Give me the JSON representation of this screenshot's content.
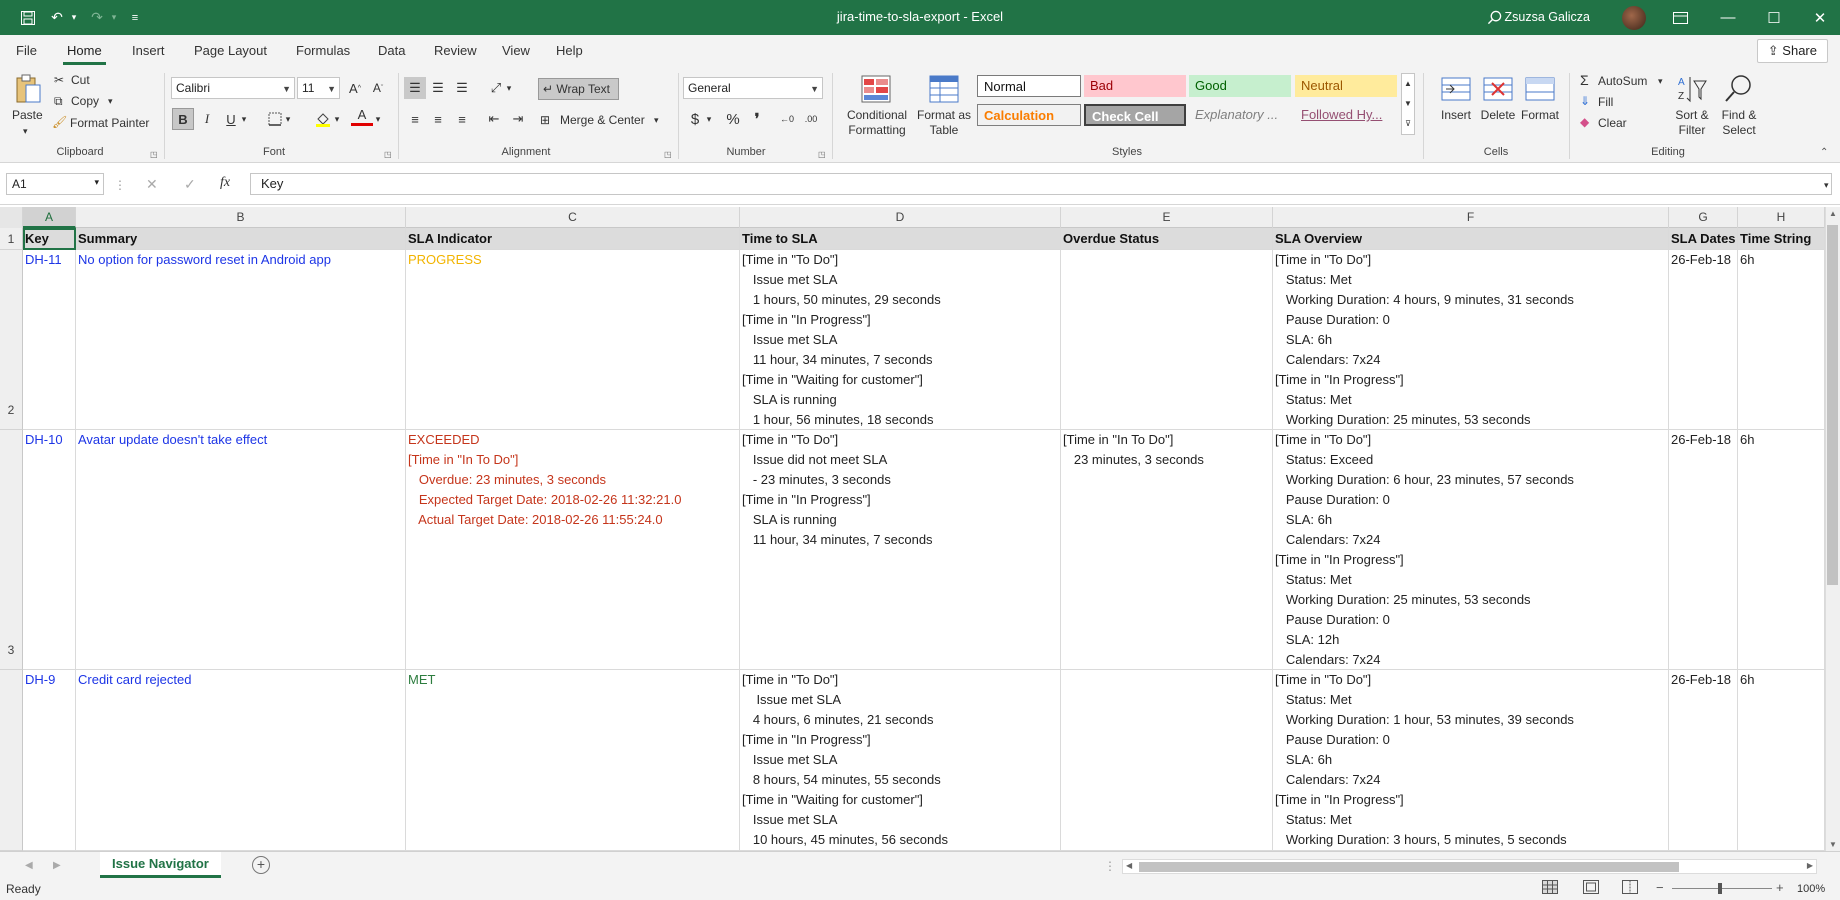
{
  "app": {
    "title": "jira-time-to-sla-export  -  Excel",
    "user": "Zsuzsa Galicza"
  },
  "menu": {
    "tabs": [
      "File",
      "Home",
      "Insert",
      "Page Layout",
      "Formulas",
      "Data",
      "Review",
      "View",
      "Help"
    ],
    "share": "Share"
  },
  "ribbon": {
    "clipboard": {
      "paste": "Paste",
      "cut": "Cut",
      "copy": "Copy",
      "format_painter": "Format Painter",
      "label": "Clipboard"
    },
    "font": {
      "name": "Calibri",
      "size": "11",
      "label": "Font"
    },
    "alignment": {
      "wrap": "Wrap Text",
      "merge": "Merge & Center",
      "label": "Alignment"
    },
    "number": {
      "format": "General",
      "label": "Number"
    },
    "styles": {
      "conditional": "Conditional",
      "conditional2": "Formatting",
      "format_as": "Format as",
      "table": "Table",
      "normal": "Normal",
      "bad": "Bad",
      "good": "Good",
      "neutral": "Neutral",
      "calculation": "Calculation",
      "check": "Check Cell",
      "explanatory": "Explanatory ...",
      "followed": "Followed Hy...",
      "label": "Styles"
    },
    "cells": {
      "insert": "Insert",
      "delete": "Delete",
      "format": "Format",
      "label": "Cells"
    },
    "editing": {
      "autosum": "AutoSum",
      "fill": "Fill",
      "clear": "Clear",
      "sort": "Sort &",
      "filter": "Filter",
      "find": "Find &",
      "select": "Select",
      "label": "Editing"
    }
  },
  "formula": {
    "namebox": "A1",
    "content": "Key"
  },
  "columns": [
    "A",
    "B",
    "C",
    "D",
    "E",
    "F",
    "G",
    "H"
  ],
  "rows": [
    "1",
    "2",
    "3"
  ],
  "headers": [
    "Key",
    "Summary",
    "SLA Indicator",
    "Time to SLA",
    "Overdue Status",
    "SLA Overview",
    "SLA Dates",
    "Time String"
  ],
  "issues": [
    {
      "key": "DH-11",
      "summary": "No option for password reset in Android app",
      "indicator": "PROGRESS",
      "indicator_color": "#f2b400",
      "time_to_sla": "[Time in \"To Do\"]\n   Issue met SLA\n   1 hours, 50 minutes, 29 seconds\n[Time in \"In Progress\"]\n   Issue met SLA\n   11 hour, 34 minutes, 7 seconds\n[Time in \"Waiting for customer\"]\n   SLA is running\n   1 hour, 56 minutes, 18 seconds",
      "overdue": "",
      "overview": "[Time in \"To Do\"]\n   Status: Met\n   Working Duration: 4 hours, 9 minutes, 31 seconds\n   Pause Duration: 0\n   SLA: 6h\n   Calendars: 7x24\n[Time in \"In Progress\"]\n   Status: Met\n   Working Duration: 25 minutes, 53 seconds",
      "date": "26-Feb-18",
      "time_string": "6h"
    },
    {
      "key": "DH-10",
      "summary": "Avatar update doesn't take effect",
      "indicator": "EXCEEDED\n[Time in \"In To Do\"]\n   Overdue: 23 minutes, 3 seconds\n   Expected Target Date: 2018-02-26 11:32:21.0\n   Actual Target Date: 2018-02-26 11:55:24.0",
      "indicator_color": "#c5351b",
      "time_to_sla": "[Time in \"To Do\"]\n   Issue did not meet SLA\n   - 23 minutes, 3 seconds\n[Time in \"In Progress\"]\n   SLA is running\n   11 hour, 34 minutes, 7 seconds",
      "overdue": "[Time in \"In To Do\"]\n   23 minutes, 3 seconds",
      "overview": "[Time in \"To Do\"]\n   Status: Exceed\n   Working Duration: 6 hour, 23 minutes, 57 seconds\n   Pause Duration: 0\n   SLA: 6h\n   Calendars: 7x24\n[Time in \"In Progress\"]\n   Status: Met\n   Working Duration: 25 minutes, 53 seconds\n   Pause Duration: 0\n   SLA: 12h\n   Calendars: 7x24",
      "date": "26-Feb-18",
      "time_string": "6h"
    },
    {
      "key": "DH-9",
      "summary": "Credit card rejected",
      "indicator": "MET",
      "indicator_color": "#2d7d3f",
      "time_to_sla": "[Time in \"To Do\"]\n    Issue met SLA\n   4 hours, 6 minutes, 21 seconds\n[Time in \"In Progress\"]\n   Issue met SLA\n   8 hours, 54 minutes, 55 seconds\n[Time in \"Waiting for customer\"]\n   Issue met SLA\n   10 hours, 45 minutes, 56 seconds",
      "overdue": "",
      "overview": "[Time in \"To Do\"]\n   Status: Met\n   Working Duration: 1 hour, 53 minutes, 39 seconds\n   Pause Duration: 0\n   SLA: 6h\n   Calendars: 7x24\n[Time in \"In Progress\"]\n   Status: Met\n   Working Duration: 3 hours, 5 minutes, 5 seconds",
      "date": "26-Feb-18",
      "time_string": "6h"
    }
  ],
  "sheet_tab": "Issue Navigator",
  "status": {
    "ready": "Ready",
    "zoom": "100%"
  }
}
